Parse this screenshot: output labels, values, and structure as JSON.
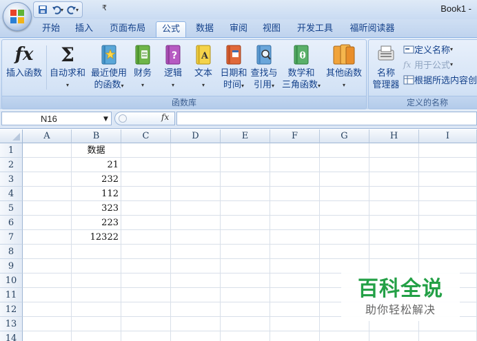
{
  "window": {
    "title": "Book1 -"
  },
  "tabs": [
    "开始",
    "插入",
    "页面布局",
    "公式",
    "数据",
    "审阅",
    "视图",
    "开发工具",
    "福昕阅读器"
  ],
  "active_tab": "公式",
  "ribbon": {
    "function_library": {
      "label": "函数库",
      "insert_function": "插入函数",
      "autosum": "自动求和",
      "recent_line1": "最近使用",
      "recent_line2": "的函数",
      "financial": "财务",
      "logical": "逻辑",
      "text": "文本",
      "datetime_line1": "日期和",
      "datetime_line2": "时间",
      "lookup_line1": "查找与",
      "lookup_line2": "引用",
      "math_line1": "数学和",
      "math_line2": "三角函数",
      "more": "其他函数"
    },
    "defined_names": {
      "label": "定义的名称",
      "name_manager_line1": "名称",
      "name_manager_line2": "管理器",
      "define_name": "定义名称",
      "use_in_formula": "用于公式",
      "create_from_selection": "根据所选内容创"
    }
  },
  "formula_bar": {
    "name_box": "N16",
    "fx_label": "fx",
    "content": ""
  },
  "sheet": {
    "columns": [
      "A",
      "B",
      "C",
      "D",
      "E",
      "F",
      "G",
      "H",
      "I"
    ],
    "rows": [
      "1",
      "2",
      "3",
      "4",
      "5",
      "6",
      "7",
      "8",
      "9",
      "10",
      "11",
      "12",
      "13",
      "14"
    ],
    "B": [
      "数据",
      "21",
      "232",
      "112",
      "323",
      "223",
      "12322"
    ]
  },
  "watermark": {
    "main": "百科全说",
    "sub": "助你轻松解决"
  }
}
